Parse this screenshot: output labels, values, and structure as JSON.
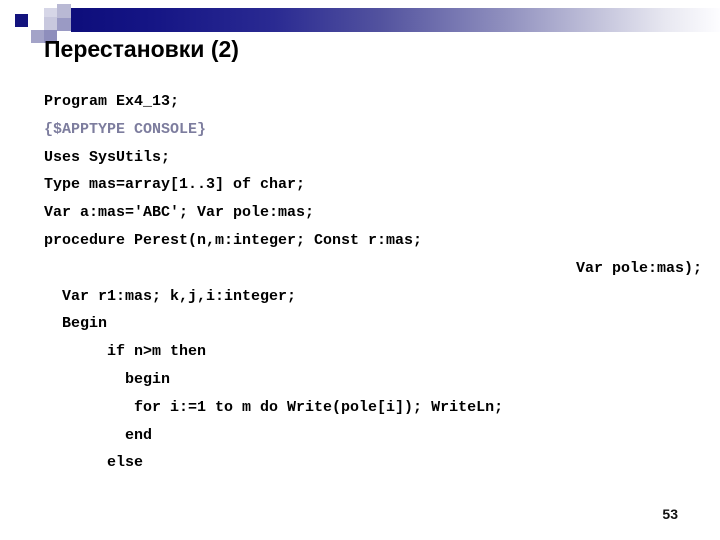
{
  "slide": {
    "title": "Перестановки (2)",
    "page_number": "53"
  },
  "banner": {
    "gradient_start_color": "#0b0b78",
    "gradient_end_color": "#ffffff",
    "accent_square_color": "#13137e",
    "light_square_color": "#b9b9d4"
  },
  "code": {
    "language": "Pascal",
    "lines": [
      {
        "text": "Program Ex4_13;",
        "style": "normal"
      },
      {
        "text": "{$APPTYPE CONSOLE}",
        "style": "dim"
      },
      {
        "text": "Uses SysUtils;",
        "style": "normal"
      },
      {
        "text": "Type mas=array[1..3] of char;",
        "style": "normal"
      },
      {
        "text": "Var a:mas='ABC'; Var pole:mas;",
        "style": "normal"
      },
      {
        "text": "procedure Perest(n,m:integer; Const r:mas;",
        "style": "normal"
      },
      {
        "text": "Var pole:mas);",
        "style": "right"
      },
      {
        "text": "  Var r1:mas; k,j,i:integer;",
        "style": "normal"
      },
      {
        "text": "  Begin",
        "style": "normal"
      },
      {
        "text": "       if n>m then",
        "style": "normal"
      },
      {
        "text": "         begin",
        "style": "normal"
      },
      {
        "text": "          for i:=1 to m do Write(pole[i]); WriteLn;",
        "style": "normal"
      },
      {
        "text": "         end",
        "style": "normal"
      },
      {
        "text": "       else",
        "style": "normal"
      }
    ]
  }
}
